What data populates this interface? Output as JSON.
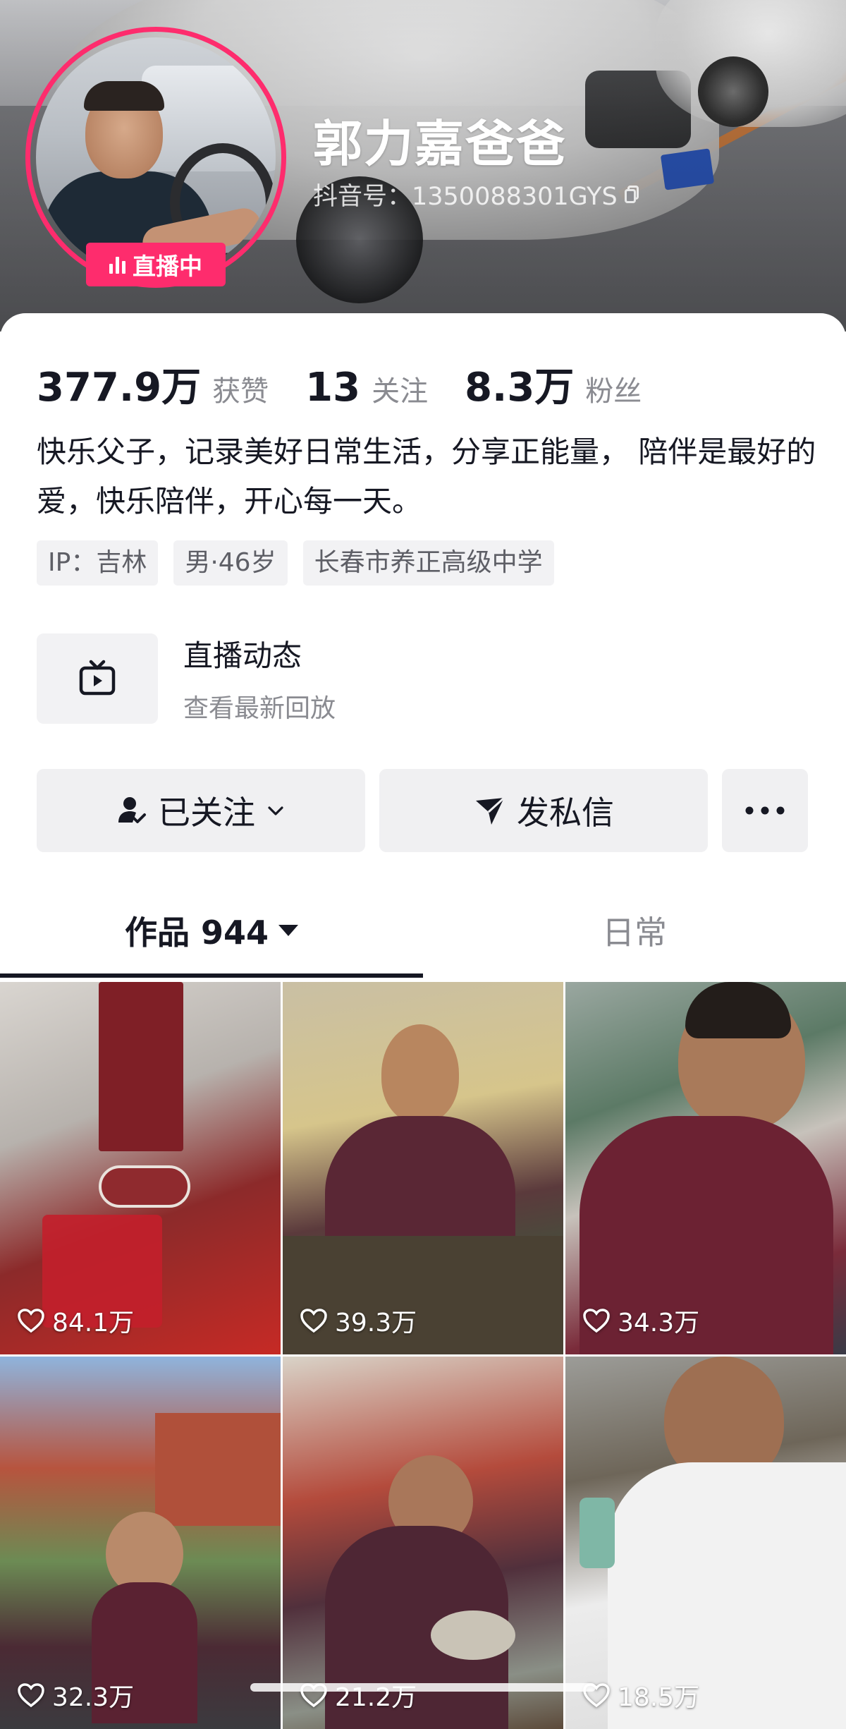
{
  "profile": {
    "nickname": "郭力嘉爸爸",
    "douyin_id": "抖音号：1350088301GYS",
    "live_badge": "直播中"
  },
  "stats": [
    {
      "value": "377.9万",
      "label": "获赞"
    },
    {
      "value": "13",
      "label": "关注"
    },
    {
      "value": "8.3万",
      "label": "粉丝"
    }
  ],
  "bio": "快乐父子，记录美好日常生活，分享正能量，  陪伴是最好的爱，快乐陪伴，开心每一天。",
  "tags": [
    "IP：吉林",
    "男·46岁",
    "长春市养正高级中学"
  ],
  "live_feed": {
    "title": "直播动态",
    "subtitle": "查看最新回放"
  },
  "actions": {
    "follow": "已关注",
    "message": "发私信"
  },
  "tabs": {
    "works": "作品 944",
    "daily": "日常"
  },
  "videos": [
    {
      "likes": "84.1万"
    },
    {
      "likes": "39.3万"
    },
    {
      "likes": "34.3万"
    },
    {
      "likes": "32.3万"
    },
    {
      "likes": "21.2万"
    },
    {
      "likes": "18.5万"
    }
  ],
  "colors": {
    "accent": "#fe2c6d",
    "text": "#161823",
    "secondary": "#8a8b91"
  }
}
